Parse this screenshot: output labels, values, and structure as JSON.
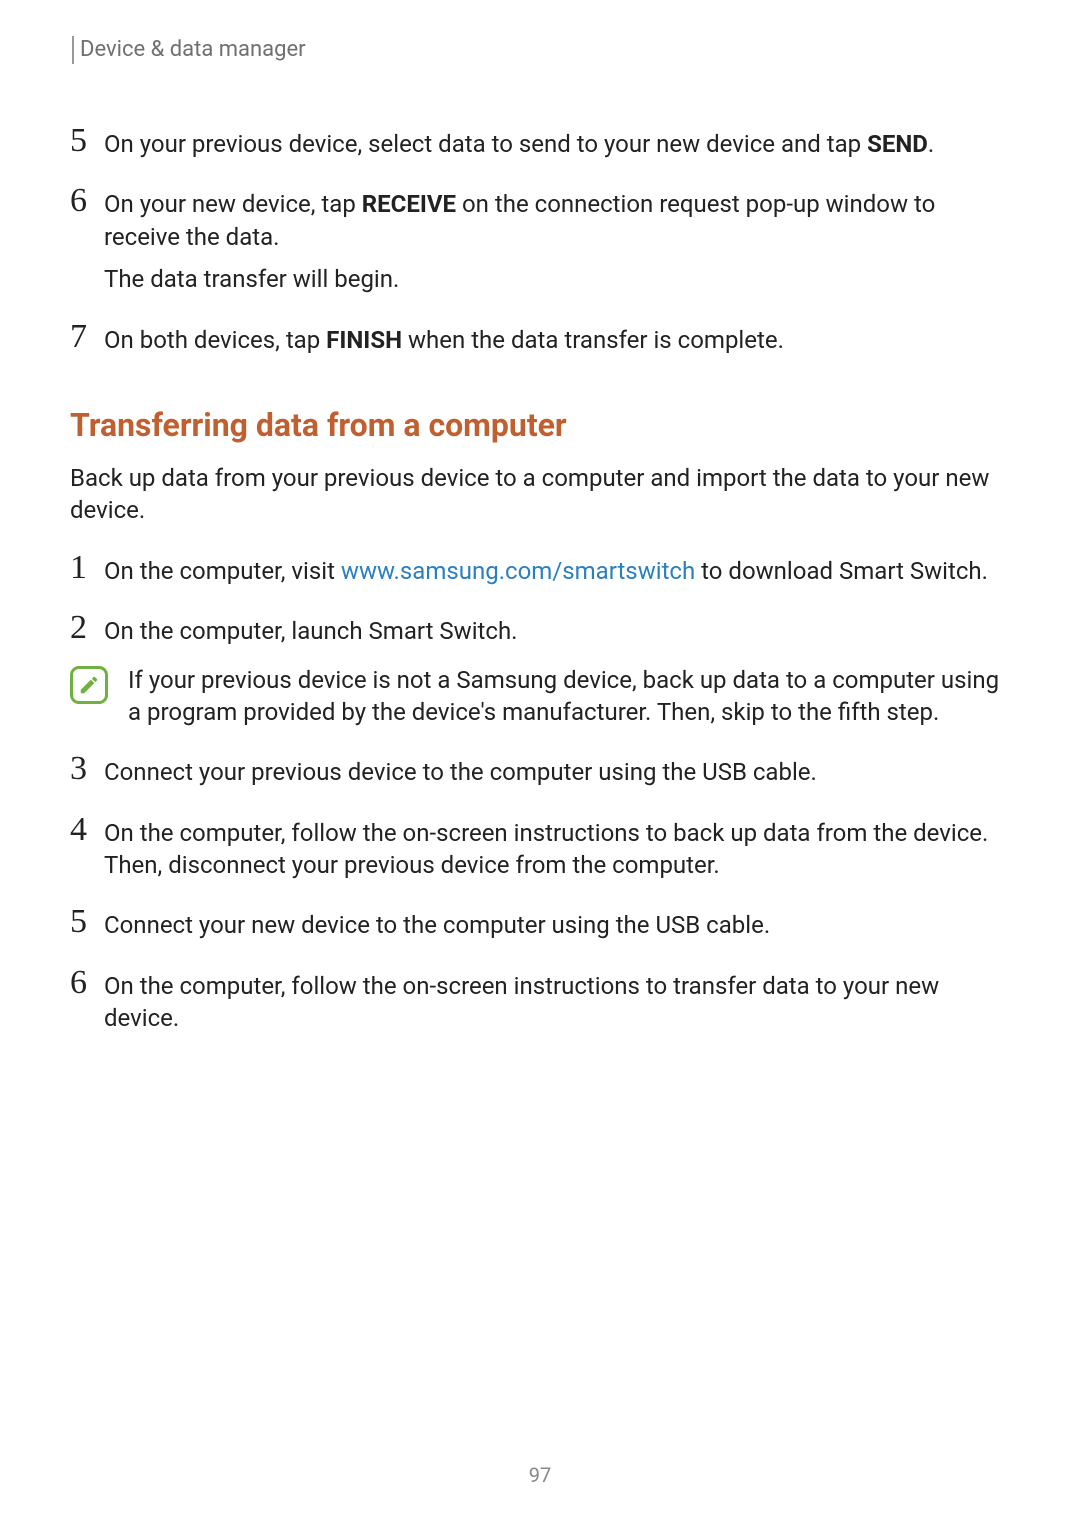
{
  "header": {
    "section_label": "Device & data manager"
  },
  "steps_a": {
    "s5": {
      "num": "5",
      "t1a": "On your previous device, select data to send to your new device and tap ",
      "t1b": "SEND",
      "t1c": "."
    },
    "s6": {
      "num": "6",
      "t1a": "On your new device, tap ",
      "t1b": "RECEIVE",
      "t1c": " on the connection request pop-up window to receive the data.",
      "t2": "The data transfer will begin."
    },
    "s7": {
      "num": "7",
      "t1a": "On both devices, tap ",
      "t1b": "FINISH",
      "t1c": " when the data transfer is complete."
    }
  },
  "section": {
    "title": "Transferring data from a computer",
    "intro": "Back up data from your previous device to a computer and import the data to your new device."
  },
  "steps_b": {
    "s1": {
      "num": "1",
      "t1a": "On the computer, visit ",
      "link": "www.samsung.com/smartswitch",
      "t1c": " to download Smart Switch."
    },
    "s2": {
      "num": "2",
      "t1": "On the computer, launch Smart Switch."
    },
    "note": {
      "t1": "If your previous device is not a Samsung device, back up data to a computer using a program provided by the device's manufacturer. Then, skip to the fifth step."
    },
    "s3": {
      "num": "3",
      "t1": "Connect your previous device to the computer using the USB cable."
    },
    "s4": {
      "num": "4",
      "t1": "On the computer, follow the on-screen instructions to back up data from the device. Then, disconnect your previous device from the computer."
    },
    "s5": {
      "num": "5",
      "t1": "Connect your new device to the computer using the USB cable."
    },
    "s6": {
      "num": "6",
      "t1": "On the computer, follow the on-screen instructions to transfer data to your new device."
    }
  },
  "page_number": "97"
}
